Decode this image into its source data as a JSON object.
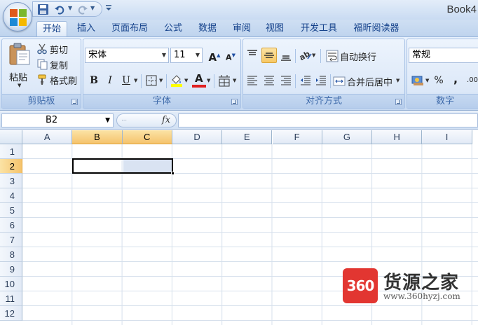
{
  "window": {
    "title": "Book4"
  },
  "quick_access": {
    "more_icon": "customize-arrow"
  },
  "tabs": [
    {
      "label": "开始",
      "active": true
    },
    {
      "label": "插入"
    },
    {
      "label": "页面布局"
    },
    {
      "label": "公式"
    },
    {
      "label": "数据"
    },
    {
      "label": "审阅"
    },
    {
      "label": "视图"
    },
    {
      "label": "开发工具"
    },
    {
      "label": "福昕阅读器"
    }
  ],
  "ribbon": {
    "clipboard": {
      "label": "剪贴板",
      "paste": "粘贴",
      "cut": "剪切",
      "copy": "复制",
      "format_painter": "格式刷"
    },
    "font": {
      "label": "字体",
      "family": "宋体",
      "size": "11",
      "grow_icon": "A",
      "shrink_icon": "A",
      "bold": "B",
      "italic": "I",
      "underline": "U",
      "font_color_letter": "A",
      "font_color": "#e02020",
      "fill_color": "#ffff00"
    },
    "alignment": {
      "label": "对齐方式",
      "wrap_text": "自动换行",
      "merge_center": "合并后居中"
    },
    "number": {
      "label": "数字",
      "format": "常规",
      "percent": "%",
      "comma": ",",
      "dec": ".00"
    }
  },
  "formula_bar": {
    "name_box": "B2",
    "fx": "fx",
    "formula": ""
  },
  "sheet": {
    "columns": [
      "A",
      "B",
      "C",
      "D",
      "E",
      "F",
      "G",
      "H",
      "I"
    ],
    "selected_columns": [
      "B",
      "C"
    ],
    "rows": [
      "1",
      "2",
      "3",
      "4",
      "5",
      "6",
      "7",
      "8",
      "9",
      "10",
      "11",
      "12"
    ],
    "selected_row": "2",
    "selection": "B2:C2"
  },
  "watermark": {
    "badge": "360",
    "name": "货源之家",
    "url": "www.360hyzj.com"
  },
  "colors": {
    "accent_selection": "#f5c36c",
    "ribbon_blue": "#c7daf2",
    "watermark_red": "#e23631"
  }
}
